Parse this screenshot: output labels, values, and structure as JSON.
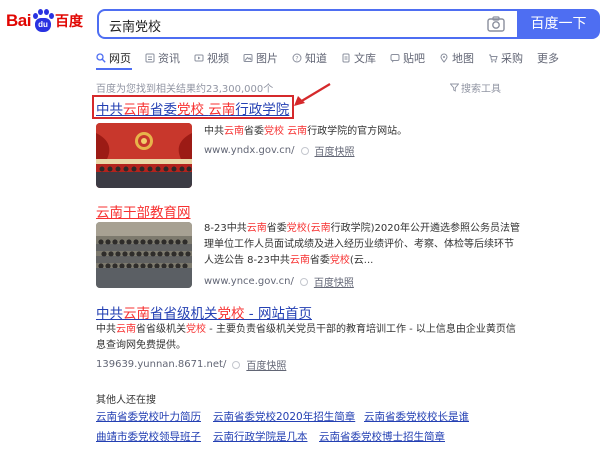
{
  "logo": {
    "bai": "Bai",
    "paw_text": "du",
    "du": "百度"
  },
  "search": {
    "query": "云南党校",
    "button_label": "百度一下"
  },
  "tabs": [
    {
      "label": "网页",
      "icon": "search-icon"
    },
    {
      "label": "资讯",
      "icon": "news-icon"
    },
    {
      "label": "视频",
      "icon": "video-icon"
    },
    {
      "label": "图片",
      "icon": "image-icon"
    },
    {
      "label": "知道",
      "icon": "question-icon"
    },
    {
      "label": "文库",
      "icon": "document-icon"
    },
    {
      "label": "贴吧",
      "icon": "tieba-icon"
    },
    {
      "label": "地图",
      "icon": "map-icon"
    },
    {
      "label": "采购",
      "icon": "cart-icon"
    },
    {
      "label": "更多",
      "icon": ""
    }
  ],
  "stats": {
    "result_count": "百度为您找到相关结果约23,300,000个",
    "tools": "搜索工具"
  },
  "results": [
    {
      "title_parts": [
        "中共",
        "云南",
        "省委",
        "党校",
        " ",
        "云南",
        "行政学院"
      ],
      "snippet_parts": [
        "中共",
        "云南",
        "省委",
        "党校",
        "云南",
        "行政学院的官方网站。"
      ],
      "url": "www.yndx.gov.cn/",
      "cache": "百度快照"
    },
    {
      "title": "云南干部教育网",
      "snippet_parts": [
        "8-23中共",
        "云南",
        "省委",
        "党校",
        "(",
        "云南",
        "行政学院)2020年公开遴选参照公务员法管理单位工作人员面试成绩及进入经历业绩评价、考察、体检等后续环节人选公告 8-23中共",
        "云南",
        "省委",
        "党校",
        "(云..."
      ],
      "url": "www.ynce.gov.cn/",
      "cache": "百度快照"
    },
    {
      "title_parts": [
        "中共",
        "云南",
        "省省级机关",
        "党校",
        " - 网站首页"
      ],
      "snippet_parts": [
        "中共",
        "云南",
        "省省级机关",
        "党校",
        " - 主要负责省级机关党员干部的教育培训工作 - 以上信息由企业黄页信息查询网免费提供。"
      ],
      "url": "139639.yunnan.8671.net/",
      "cache": "百度快照"
    }
  ],
  "related": {
    "title": "其他人还在搜",
    "items": [
      "云南省委党校叶力简历",
      "云南省委党校2020年招生简章",
      "云南省委党校校长是谁",
      "曲靖市委党校领导班子",
      "云南行政学院是几本",
      "云南省委党校博士招生简章"
    ]
  },
  "colors": {
    "accent": "#4e6ef2",
    "link": "#2440b3",
    "highlight": "#f73131",
    "annotation": "#d5292b"
  }
}
